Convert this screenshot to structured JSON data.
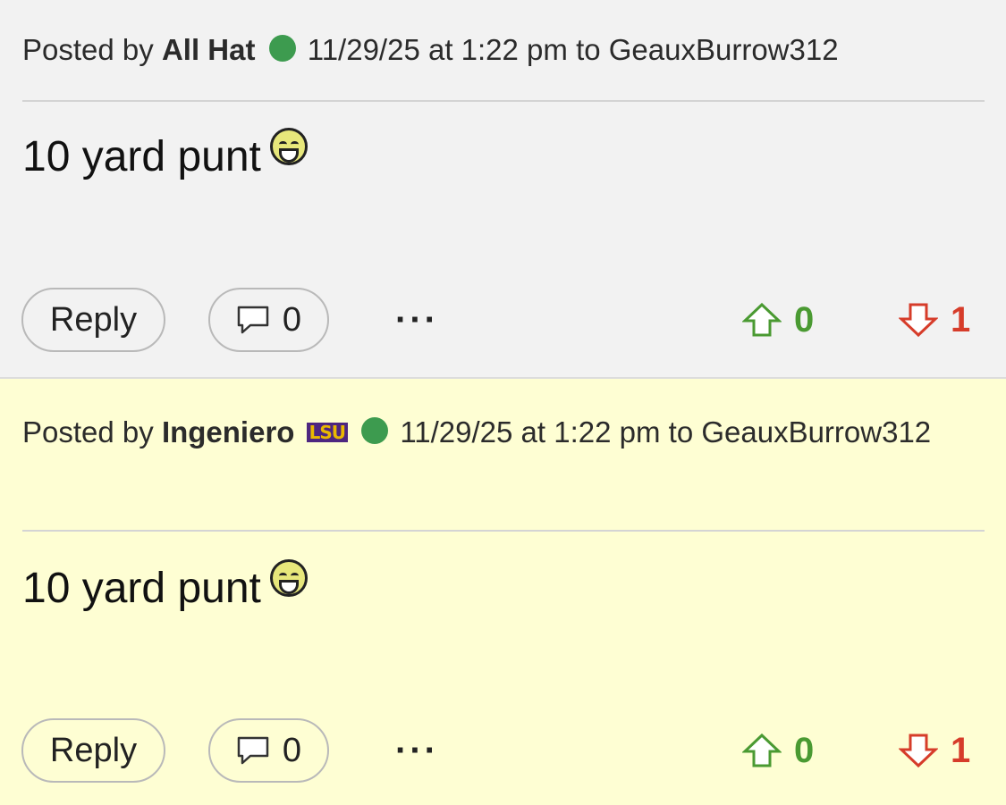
{
  "posts": [
    {
      "posted_by_label": "Posted by",
      "author": "All Hat",
      "team_badge": "",
      "timestamp": "11/29/25 at 1:22 pm to GeauxBurrow312",
      "body": "10 yard punt",
      "reply_label": "Reply",
      "comment_count": "0",
      "more_label": "···",
      "upvotes": "0",
      "downvotes": "1",
      "background": "#f2f2f2"
    },
    {
      "posted_by_label": "Posted by",
      "author": "Ingeniero",
      "team_badge": "LSU",
      "timestamp": "11/29/25 at 1:22 pm to GeauxBurrow312",
      "body": "10 yard punt",
      "reply_label": "Reply",
      "comment_count": "0",
      "more_label": "···",
      "upvotes": "0",
      "downvotes": "1",
      "background": "#fefed3"
    }
  ],
  "icons": {
    "online": "online-status-dot",
    "emoji": "laughing-emoji-icon",
    "comment": "comment-bubble-icon",
    "upvote": "upvote-arrow-icon",
    "downvote": "downvote-arrow-icon"
  },
  "colors": {
    "online": "#3d9b4f",
    "upvote": "#4a9a32",
    "downvote": "#d63c2a",
    "lsu_purple": "#4d2680",
    "lsu_gold": "#e9b800"
  }
}
